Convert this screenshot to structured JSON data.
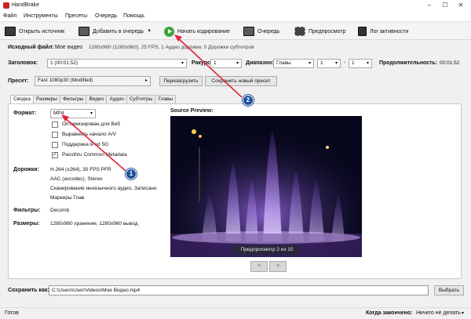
{
  "window": {
    "title": "HandBrake",
    "controls": [
      "–",
      "☐",
      "✕"
    ]
  },
  "menu": [
    "Файл",
    "Инструменты",
    "Пресеты",
    "Очередь",
    "Помощь"
  ],
  "toolbar": {
    "open_source": "Открыть источник",
    "add_to_queue": "Добавить в очередь",
    "start_encode": "Начать кодирование",
    "queue": "Очередь",
    "preview": "Предпросмотр",
    "activity_log": "Лог активности"
  },
  "source": {
    "label": "Исходный файл:",
    "name": "Мое видео",
    "details": "1280x960 (1280x960), 25 FPS, 1 Аудио дорожки, 0 Дорожки субтитров"
  },
  "title_row": {
    "title_label": "Заголовок:",
    "title_value": "1 (00:01:52)",
    "angle_label": "Ракурс:",
    "angle_value": "1",
    "range_label": "Диапазон:",
    "range_type": "Главы",
    "range_from": "1",
    "range_sep": "-",
    "range_to": "1",
    "duration_label": "Продолжительность:",
    "duration_value": "00:01:52"
  },
  "preset": {
    "label": "Пресет:",
    "value": "Fast 1080p30 (Modified)",
    "reload": "Перезагрузить",
    "save_new": "Сохранить новый пресет"
  },
  "tabs": [
    "Сводка",
    "Размеры",
    "Фильтры",
    "Видео",
    "Аудио",
    "Субтитры",
    "Главы"
  ],
  "summary": {
    "format_label": "Формат:",
    "format_value": "MP4",
    "options": [
      {
        "label": "Оптимизирован для Веб",
        "checked": false
      },
      {
        "label": "Выравнить начало A/V",
        "checked": false
      },
      {
        "label": "Поддержка iPod 5G",
        "checked": false
      },
      {
        "label": "Passthru Common Metadata",
        "checked": true
      }
    ],
    "tracks_label": "Дорожки:",
    "tracks": [
      "H.264 (x264), 30 FPS PFR",
      "AAC (avcodec), Stereo",
      "Сканирование иноязычного аудио, Записано",
      "Маркеры Глав"
    ],
    "filters_label": "Фильтры:",
    "filters_value": "Decomb",
    "sizes_label": "Размеры:",
    "sizes_value": "1280x960 хранение, 1280x960 вывод"
  },
  "preview": {
    "label": "Source Preview:",
    "caption": "Предпросмотр 2 из 10",
    "prev": "<",
    "next": ">"
  },
  "save": {
    "label": "Сохранить как:",
    "path": "C:\\Users\\User\\Videos\\Мое Видео.mp4",
    "browse": "Выбрать"
  },
  "status": {
    "left": "Готов",
    "when_done_label": "Когда закончено:",
    "when_done_value": "Ничего не делать"
  },
  "callouts": {
    "one": "1",
    "two": "2"
  },
  "colors": {
    "annotation_red": "#e0243a",
    "callout_blue": "#1e4f9c"
  }
}
